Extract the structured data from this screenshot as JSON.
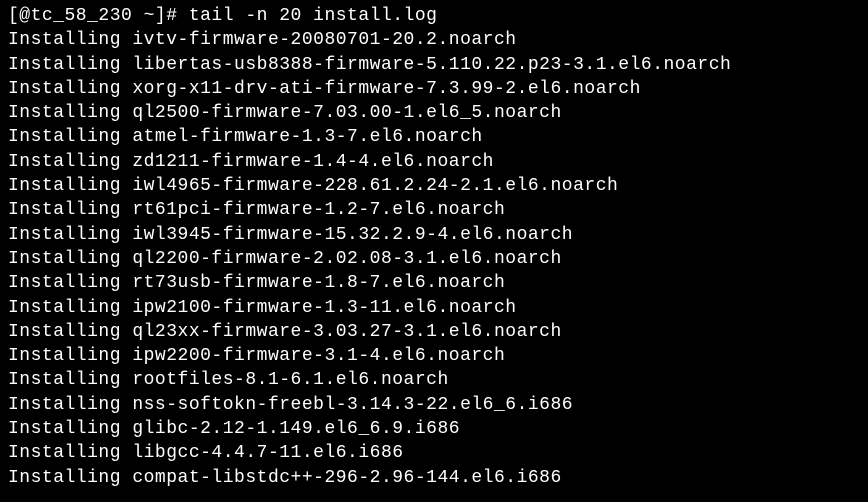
{
  "prompt": {
    "user_host_prefix": "[@tc_58_230 ~]# ",
    "command": "tail -n 20 install.log"
  },
  "lines": [
    "Installing ivtv-firmware-20080701-20.2.noarch",
    "Installing libertas-usb8388-firmware-5.110.22.p23-3.1.el6.noarch",
    "Installing xorg-x11-drv-ati-firmware-7.3.99-2.el6.noarch",
    "Installing ql2500-firmware-7.03.00-1.el6_5.noarch",
    "Installing atmel-firmware-1.3-7.el6.noarch",
    "Installing zd1211-firmware-1.4-4.el6.noarch",
    "Installing iwl4965-firmware-228.61.2.24-2.1.el6.noarch",
    "Installing rt61pci-firmware-1.2-7.el6.noarch",
    "Installing iwl3945-firmware-15.32.2.9-4.el6.noarch",
    "Installing ql2200-firmware-2.02.08-3.1.el6.noarch",
    "Installing rt73usb-firmware-1.8-7.el6.noarch",
    "Installing ipw2100-firmware-1.3-11.el6.noarch",
    "Installing ql23xx-firmware-3.03.27-3.1.el6.noarch",
    "Installing ipw2200-firmware-3.1-4.el6.noarch",
    "Installing rootfiles-8.1-6.1.el6.noarch",
    "Installing nss-softokn-freebl-3.14.3-22.el6_6.i686",
    "Installing glibc-2.12-1.149.el6_6.9.i686",
    "Installing libgcc-4.4.7-11.el6.i686",
    "Installing compat-libstdc++-296-2.96-144.el6.i686"
  ]
}
